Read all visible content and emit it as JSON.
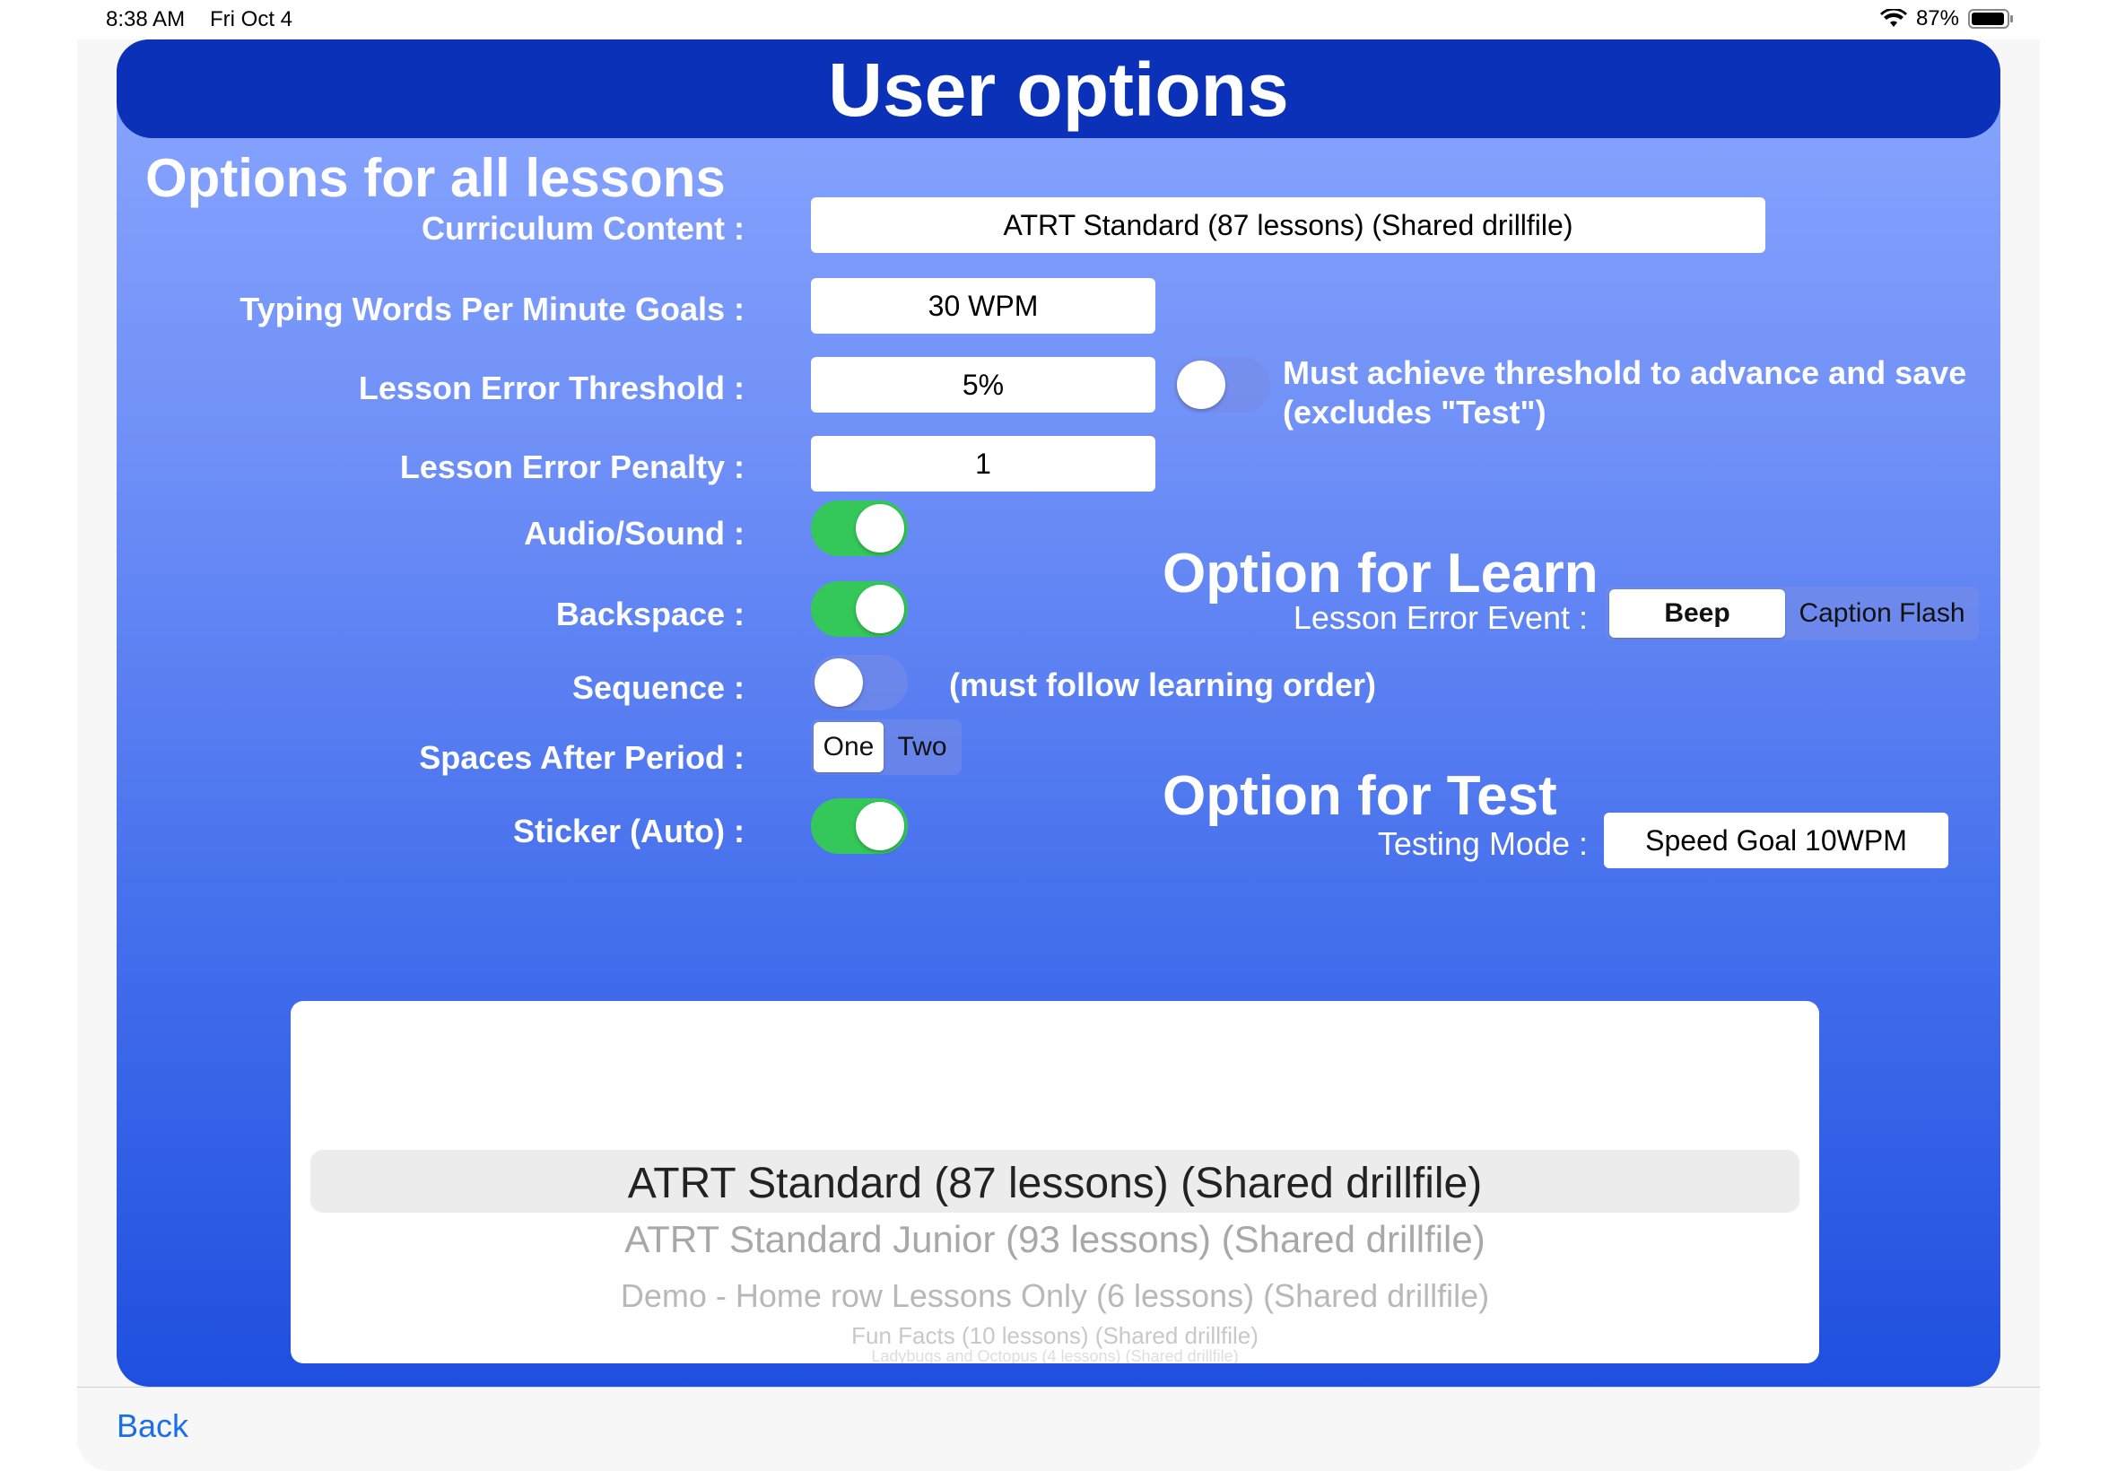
{
  "status_bar": {
    "time": "8:38 AM",
    "date": "Fri Oct 4",
    "battery": "87%"
  },
  "header": {
    "title": "User options"
  },
  "all_lessons": {
    "title": "Options for all lessons",
    "curriculum_label": "Curriculum Content :",
    "curriculum_value": "ATRT Standard (87 lessons) (Shared drillfile)",
    "wpm_label": "Typing Words Per Minute Goals :",
    "wpm_value": "30 WPM",
    "threshold_label": "Lesson Error Threshold :",
    "threshold_value": "5%",
    "threshold_note_1": "Must achieve threshold to advance and save",
    "threshold_note_2": "(excludes \"Test\")",
    "threshold_toggle_on": false,
    "penalty_label": "Lesson Error Penalty :",
    "penalty_value": "1",
    "audio_label": "Audio/Sound :",
    "audio_on": true,
    "backspace_label": "Backspace :",
    "backspace_on": true,
    "sequence_label": "Sequence :",
    "sequence_on": false,
    "sequence_note": "(must follow learning order)",
    "spaces_label": "Spaces After Period :",
    "spaces_options": [
      "One",
      "Two"
    ],
    "spaces_selected": "One",
    "sticker_label": "Sticker (Auto) :",
    "sticker_on": true
  },
  "learn": {
    "title": "Option for Learn",
    "error_event_label": "Lesson Error Event :",
    "error_event_options": [
      "Beep",
      "Caption Flash"
    ],
    "error_event_selected": "Beep"
  },
  "test": {
    "title": "Option for Test",
    "mode_label": "Testing Mode :",
    "mode_value": "Speed Goal 10WPM"
  },
  "picker": {
    "items": [
      "ATRT Standard (87 lessons) (Shared drillfile)",
      "ATRT Standard Junior (93 lessons) (Shared drillfile)",
      "Demo - Home row Lessons Only (6 lessons) (Shared drillfile)",
      "Fun Facts (10 lessons) (Shared drillfile)",
      "Ladybugs and Octopus (4 lessons) (Shared drillfile)"
    ],
    "selected_index": 0
  },
  "bottom": {
    "back_label": "Back"
  },
  "colors": {
    "header": "#0a31b8",
    "toggle_on": "#34c759",
    "link": "#1a6fe8"
  }
}
